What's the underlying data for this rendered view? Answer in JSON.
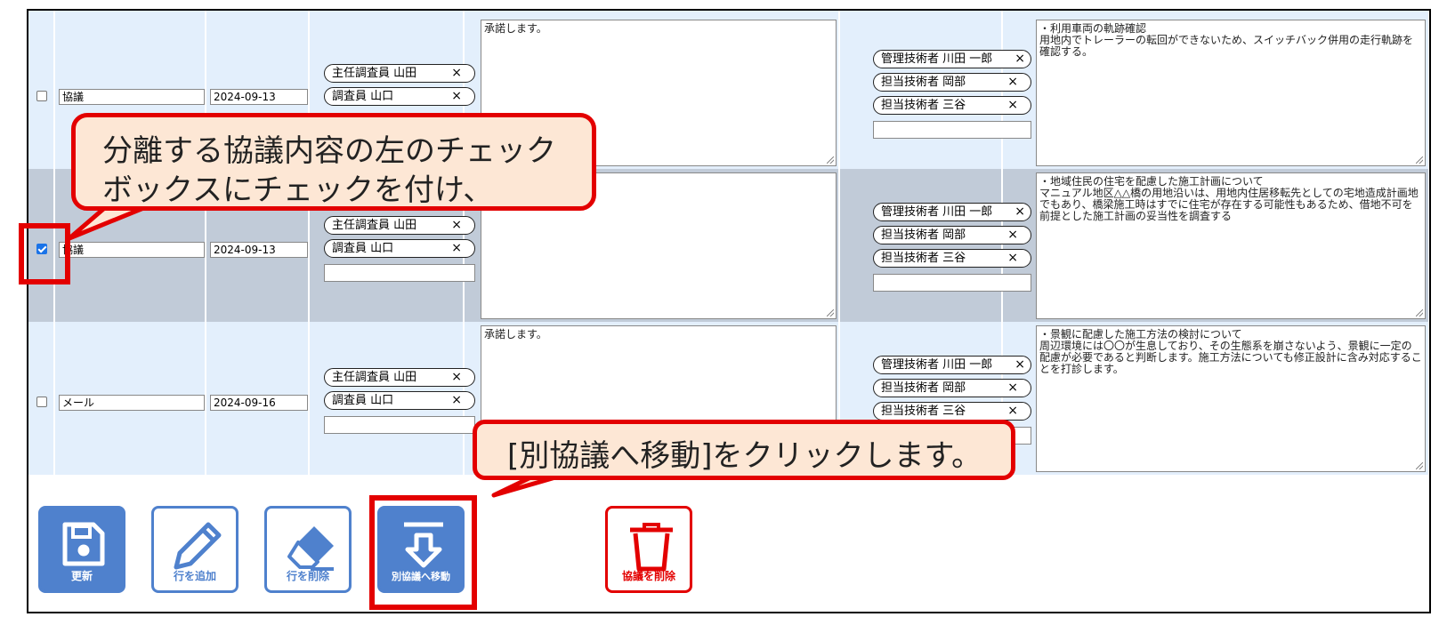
{
  "rows": [
    {
      "checked": false,
      "type": "協議",
      "date": "2024-09-13",
      "investigators": [
        "主任調査員 山田",
        "調査員 山口"
      ],
      "response": "承諾します。",
      "engineers": [
        "管理技術者 川田 一郎",
        "担当技術者 岡部",
        "担当技術者 三谷"
      ],
      "content": "・利用車両の軌跡確認\n用地内でトレーラーの転回ができないため、スイッチバック併用の走行軌跡を確認する。"
    },
    {
      "checked": true,
      "type": "協議",
      "date": "2024-09-13",
      "investigators": [
        "主任調査員 山田",
        "調査員 山口"
      ],
      "response": "",
      "engineers": [
        "管理技術者 川田 一郎",
        "担当技術者 岡部",
        "担当技術者 三谷"
      ],
      "content": "・地域住民の住宅を配慮した施工計画について\nマニュアル地区△△橋の用地沿いは、用地内住居移転先としての宅地造成計画地でもあり、橋梁施工時はすでに住宅が存在する可能性もあるため、借地不可を前提とした施工計画の妥当性を調査する"
    },
    {
      "checked": false,
      "type": "メール",
      "date": "2024-09-16",
      "investigators": [
        "主任調査員 山田",
        "調査員 山口"
      ],
      "response": "承諾します。",
      "engineers": [
        "管理技術者 川田 一郎",
        "担当技術者 岡部",
        "担当技術者 三谷"
      ],
      "content": "・景観に配慮した施工方法の検討について\n周辺環境には〇〇が生息しており、その生態系を崩さないよう、景観に一定の配慮が必要であると判断します。施工方法についても修正設計に含み対応することを打診します。"
    }
  ],
  "remove_mark": "×",
  "toolbar": {
    "update": "更新",
    "add_row": "行を追加",
    "delete_row": "行を削除",
    "move": "別協議へ移動",
    "delete_consultation": "協議を削除"
  },
  "callouts": {
    "first_line1": "分離する協議内容の左のチェック",
    "first_line2": "ボックスにチェックを付け、",
    "second": "[別協議へ移動]をクリックします。"
  },
  "colors": {
    "row_light": "#e3effc",
    "row_selected": "#c1cbd8",
    "button_blue": "#4f81cd",
    "danger_red": "#e30000",
    "callout_fill": "#fde7d5"
  }
}
